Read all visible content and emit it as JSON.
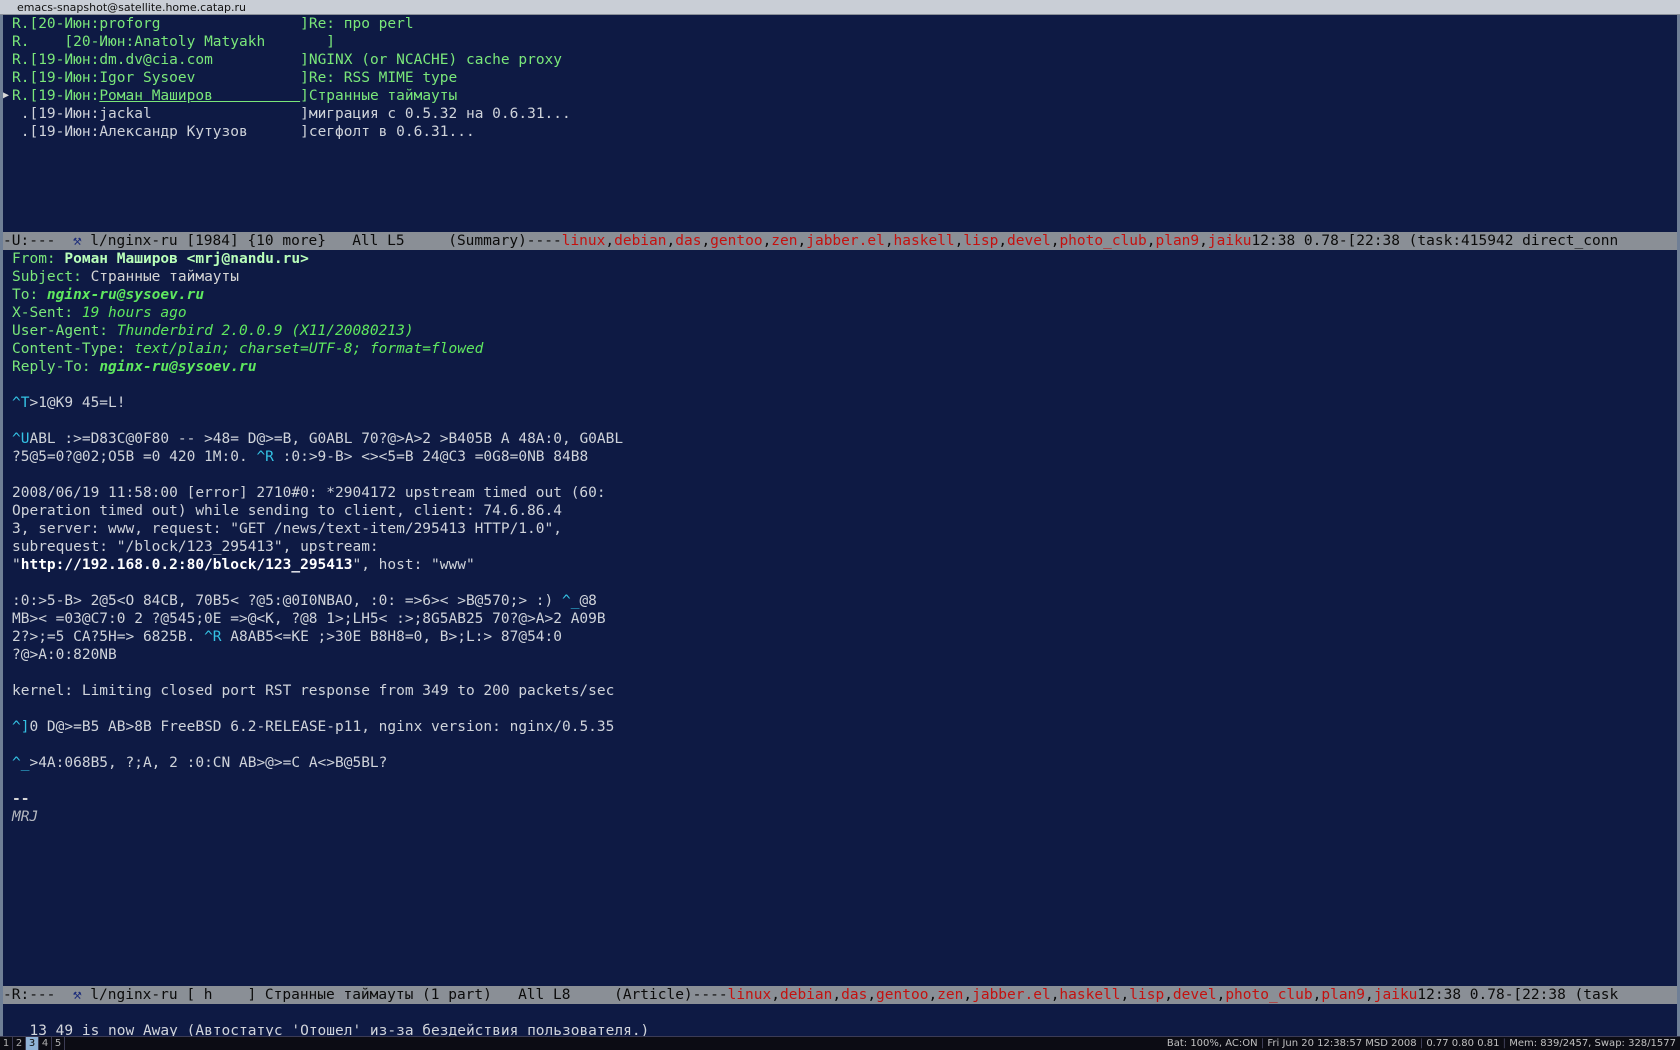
{
  "window_title": "emacs-snapshot@satellite.home.catap.ru",
  "summary": {
    "lines": [
      {
        "mark": "R.",
        "date": "[20-Июн:",
        "author": "proforg                ",
        "close": "]",
        "subject": "Re: про perl",
        "state": "replied"
      },
      {
        "mark": "R.",
        "date": "    [20-Июн:",
        "author": "Anatoly Matyakh       ",
        "close": "]",
        "subject": "",
        "state": "replied"
      },
      {
        "mark": "R.",
        "date": "[19-Июн:",
        "author": "dm.dv@cia.com          ",
        "close": "]",
        "subject": "NGINX (or NCACHE) cache proxy",
        "state": "replied"
      },
      {
        "mark": "R.",
        "date": "[19-Июн:",
        "author": "Igor Sysoev            ",
        "close": "]",
        "subject": "Re: RSS MIME type",
        "state": "replied"
      },
      {
        "mark": "R.",
        "date": "[19-Июн:",
        "author": "Роман Маширов          ",
        "close": "]",
        "subject": "Странные таймауты",
        "state": "current"
      },
      {
        "mark": " .",
        "date": "[19-Июн:",
        "author": "jackal                 ",
        "close": "]",
        "subject": "миграция с 0.5.32 на 0.6.31...",
        "state": "normal"
      },
      {
        "mark": " .",
        "date": "[19-Июн:",
        "author": "Александр Кутузов      ",
        "close": "]",
        "subject": "сегфолт в 0.6.31...",
        "state": "normal"
      }
    ]
  },
  "modeline_summary": {
    "left": "-U:---  ",
    "buffer": " l/nginx-ru [1984] {10 more}   All L5     (Summary)----",
    "tags": [
      "linux",
      "debian",
      "das",
      "gentoo",
      "zen",
      "jabber.el",
      "haskell",
      "lisp",
      "devel",
      "photo_club",
      "plan9",
      "jaiku"
    ],
    "right": "12:38 0.78-[22:38 (task:415942 direct_conn"
  },
  "headers": {
    "from_label": "From: ",
    "from_value": "Роман Маширов <mrj@nandu.ru>",
    "subject_label": "Subject: ",
    "subject_value": "Странные таймауты",
    "to_label": "To: ",
    "to_value": "nginx-ru@sysoev.ru",
    "xsent_label": "X-Sent: ",
    "xsent_value": "19 hours ago",
    "ua_label": "User-Agent: ",
    "ua_value": "Thunderbird 2.0.0.9 (X11/20080213)",
    "ct_label": "Content-Type: ",
    "ct_value": "text/plain; charset=UTF-8; format=flowed",
    "reply_label": "Reply-To: ",
    "reply_value": "nginx-ru@sysoev.ru"
  },
  "body": {
    "p1_ctl": "^T",
    "p1": ">1@K9 45=L!",
    "p2_ctl": "^U",
    "p2a": "ABL :>=D83C@0F80 -- >48= D@>=B, G0ABL 70?@>A>2 >B405B A 48A:0, G0ABL",
    "p2b_a": "?5@5=0?@02;O5B =0 420 1M:0. ",
    "p2b_ctl": "^R",
    "p2b_b": " :0:>9-B> <><5=B 24@C3 =0G8=0NB 84B8",
    "log1": "2008/06/19 11:58:00 [error] 2710#0: *2904172 upstream timed out (60:",
    "log2": "Operation timed out) while sending to client, client: 74.6.86.4",
    "log3": "3, server: www, request: \"GET /news/text-item/295413 HTTP/1.0\",",
    "log4": "subrequest: \"/block/123_295413\", upstream:",
    "log5_q": "\"",
    "log5_url": "http://192.168.0.2:80/block/123_295413",
    "log5_rest": "\", host: \"www\"",
    "p3a_a": ":0:>5-B> 2@5<O 84CB, 70B5< ?@5:@0I0NBAO, :0: =>6>< >B@570;> :) ",
    "p3a_ctl": "^_",
    "p3a_b": "@8",
    "p3b": "MB>< =03@C7:0 2 ?@545;0E =>@<K, ?@8 1>;LH5< :>;8G5AB25 70?@>A>2 A09B",
    "p3c_a": "2?>;=5 CA?5H=> 6825B. ",
    "p3c_ctl": "^R",
    "p3c_b": " A8AB5<=KE ;>30E B8H8=0, B>;L:> 87@54:0",
    "p3d": "?@>A:0:820NB",
    "kernel": "kernel: Limiting closed port RST response from 349 to 200 packets/sec",
    "p4_ctl": "^]",
    "p4": "0 D@>=B5 AB>8B FreeBSD 6.2-RELEASE-p11, nginx version: nginx/0.5.35",
    "p5_ctl": "^_",
    "p5": ">4A:068B5, ?;A, 2 :0:CN AB>@>=C A<>B@5BL?",
    "sig_dash": "--",
    "sig_name": "MRJ"
  },
  "modeline_article": {
    "left": "-R:---  ",
    "buffer": " l/nginx-ru [ h    ] Странные таймауты (1 part)   All L8     (Article)----",
    "tags": [
      "linux",
      "debian",
      "das",
      "gentoo",
      "zen",
      "jabber.el",
      "haskell",
      "lisp",
      "devel",
      "photo_club",
      "plan9",
      "jaiku"
    ],
    "right": "12:38 0.78-[22:38 (task"
  },
  "minibuffer": "13_49 is now Away (Автостатус 'Отошел' из-за бездействия пользователя.)",
  "taskbar": {
    "workspaces": [
      "1",
      "2",
      "3",
      "4",
      "5"
    ],
    "active_workspace": "3",
    "battery": "Bat: 100%, AC:ON",
    "datetime": "Fri Jun 20 12:38:57 MSD 2008",
    "load": "0.77 0.80 0.81",
    "mem": "Mem: 839/2457, Swap: 328/1577"
  },
  "colors": {
    "background": "#0e1a44",
    "header_green": "#7ae77a",
    "modeline_gray": "#8a8f96",
    "tag_red": "#c4110f",
    "control_cyan": "#34c2e4"
  },
  "icons": {
    "mode_icon": "gnus-icon",
    "current_marker": "triangle-right-icon"
  }
}
